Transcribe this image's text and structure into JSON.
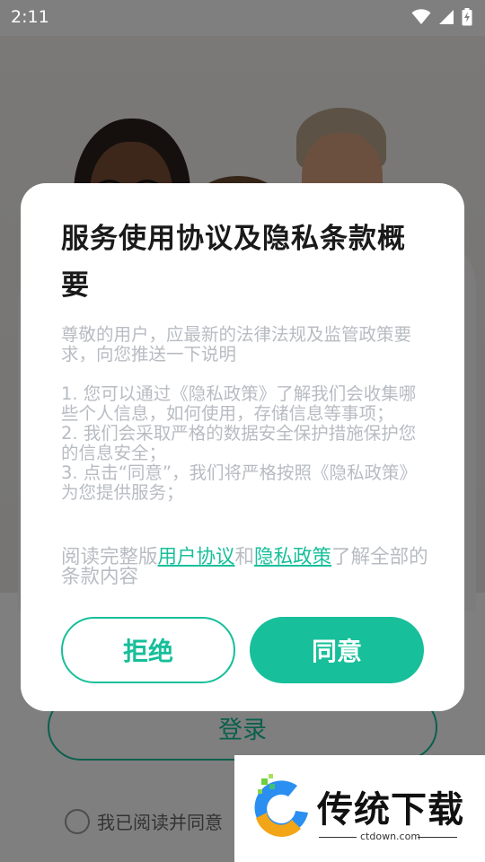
{
  "status_bar": {
    "time": "2:11",
    "icons": [
      "wifi-icon",
      "cell-signal-icon",
      "battery-charging-icon"
    ]
  },
  "background_screen": {
    "login_label": "登录",
    "agreement_text": "我已阅读并同意"
  },
  "dialog": {
    "title": "服务使用协议及隐私条款概要",
    "body": "尊敬的用户，应最新的法律法规及监管政策要求，向您推送一下说明\n\n1. 您可以通过《隐私政策》了解我们会收集哪些个人信息，如何使用，存储信息等事项；\n2. 我们会采取严格的数据安全保护措施保护您的信息安全；\n3. 点击“同意”，我们将严格按照《隐私政策》为您提供服务；",
    "read_prefix": "阅读完整版",
    "user_agreement_link": "用户协议",
    "read_and": "和",
    "privacy_policy_link": "隐私政策",
    "read_suffix": "了解全部的条款内容",
    "refuse_label": "拒绝",
    "agree_label": "同意"
  },
  "watermark": {
    "brand": "传统下载",
    "url": "ctdown.com"
  },
  "colors": {
    "accent": "#17bf9a",
    "title": "#1a1a1a",
    "body_text": "#b8bcc2",
    "scrim": "rgba(0,0,0,0.5)"
  }
}
